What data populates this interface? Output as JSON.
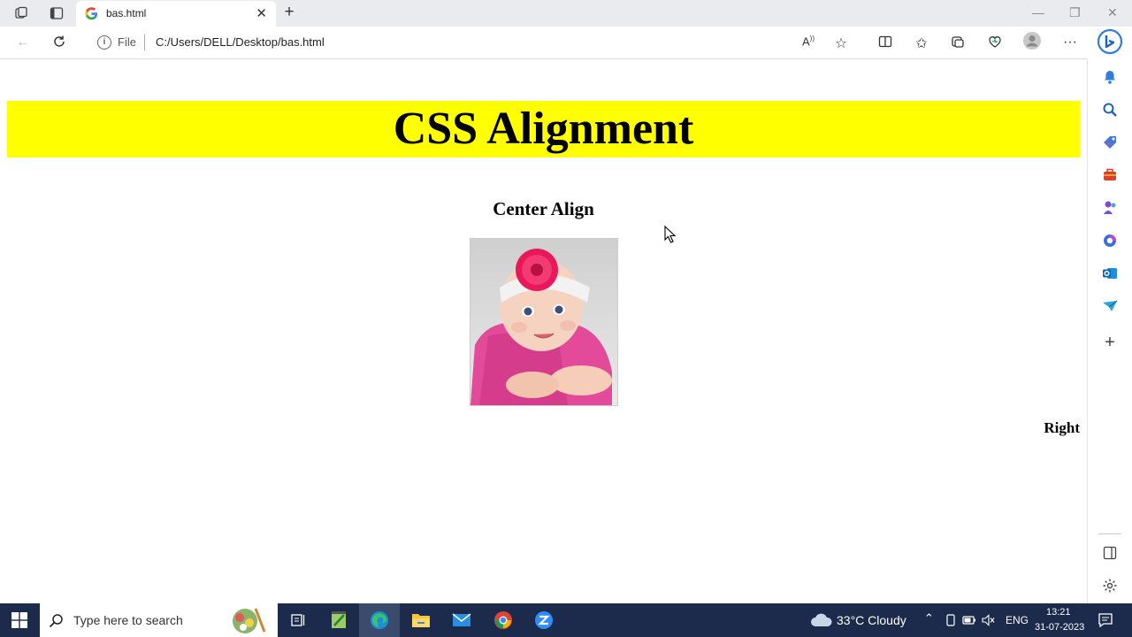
{
  "browser": {
    "tab_title": "bas.html",
    "address_scheme_label": "File",
    "address_url": "C:/Users/DELL/Desktop/bas.html"
  },
  "page": {
    "banner_title": "CSS Alignment",
    "center_heading": "Center Align",
    "right_label": "Right",
    "banner_color": "#ffff00"
  },
  "taskbar": {
    "search_placeholder": "Type here to search",
    "weather": "33°C  Cloudy",
    "language": "ENG",
    "time": "13:21",
    "date": "31-07-2023",
    "color": "#1c2b4b"
  }
}
